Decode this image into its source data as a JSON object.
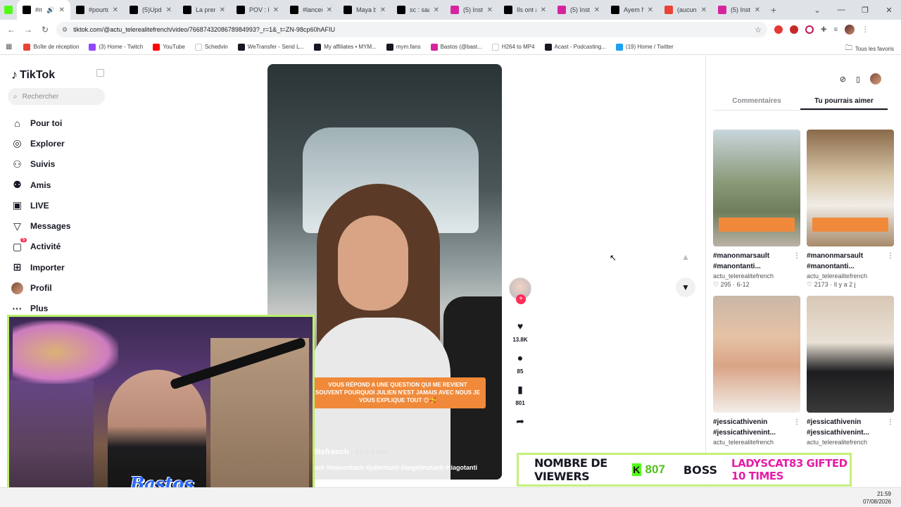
{
  "browser": {
    "tabs": [
      {
        "label": "",
        "icon": "kick-icon",
        "color": "#53fc18"
      },
      {
        "label": "#ma",
        "icon": "tiktok-icon",
        "color": "#000000",
        "active": true
      },
      {
        "label": "#pourto",
        "icon": "tiktok-icon",
        "color": "#000000"
      },
      {
        "label": "(5)Upda",
        "icon": "tiktok-icon",
        "color": "#000000"
      },
      {
        "label": "La prem",
        "icon": "tiktok-icon",
        "color": "#000000"
      },
      {
        "label": "POV : Le",
        "icon": "tiktok-icon",
        "color": "#000000"
      },
      {
        "label": "#lanceu",
        "icon": "tiktok-icon",
        "color": "#000000"
      },
      {
        "label": "Maya b",
        "icon": "tiktok-icon",
        "color": "#000000"
      },
      {
        "label": "sc : saal",
        "icon": "tiktok-icon",
        "color": "#000000"
      },
      {
        "label": "(5) Insta",
        "icon": "instagram-icon",
        "color": "#d6249f"
      },
      {
        "label": "Ils ont a",
        "icon": "tiktok-icon",
        "color": "#000000"
      },
      {
        "label": "(5) Insta",
        "icon": "instagram-icon",
        "color": "#d6249f"
      },
      {
        "label": "Ayem N",
        "icon": "tiktok-icon",
        "color": "#000000"
      },
      {
        "label": "(aucun",
        "icon": "gmail-icon",
        "color": "#ea4335"
      },
      {
        "label": "(5) Insta",
        "icon": "instagram-icon",
        "color": "#d6249f"
      }
    ],
    "new_tab": "+",
    "url": "tiktok.com/@actu_telerealitefrench/video/7668743208678984993?_r=1&_t=ZN-98cp60hAFIU",
    "bookmarks": [
      {
        "label": "Boîte de réception",
        "color": "#ea4335"
      },
      {
        "label": "(3) Home - Twitch",
        "color": "#9146ff"
      },
      {
        "label": "YouTube",
        "color": "#ff0000"
      },
      {
        "label": "Schedvin",
        "color": "#ffffff"
      },
      {
        "label": "WeTransfer - Send L...",
        "color": "#161823"
      },
      {
        "label": "My affiliates • MYM...",
        "color": "#161823"
      },
      {
        "label": "mym.fans",
        "color": "#161823"
      },
      {
        "label": "Bastos (@bast...",
        "color": "#d6249f"
      },
      {
        "label": "H264 to MP4",
        "color": "#ffffff"
      },
      {
        "label": "Acast - Podcasting...",
        "color": "#161823"
      },
      {
        "label": "(19) Home / Twitter",
        "color": "#1da1f2"
      }
    ],
    "all_bookmarks": "Tous les favoris"
  },
  "tiktok": {
    "logo": "TikTok",
    "search_placeholder": "Rechercher",
    "nav": [
      {
        "label": "Pour toi",
        "icon": "home-icon",
        "glyph": "⌂"
      },
      {
        "label": "Explorer",
        "icon": "compass-icon",
        "glyph": "◎"
      },
      {
        "label": "Suivis",
        "icon": "following-icon",
        "glyph": "⚇"
      },
      {
        "label": "Amis",
        "icon": "friends-icon",
        "glyph": "⚉"
      },
      {
        "label": "LIVE",
        "icon": "live-icon",
        "glyph": "▣"
      },
      {
        "label": "Messages",
        "icon": "messages-icon",
        "glyph": "▽"
      },
      {
        "label": "Activité",
        "icon": "activity-icon",
        "glyph": "▢",
        "badge": "5"
      },
      {
        "label": "Importer",
        "icon": "upload-icon",
        "glyph": "⊞"
      },
      {
        "label": "Profil",
        "icon": "profile-avatar",
        "glyph": ""
      },
      {
        "label": "Plus",
        "icon": "more-icon",
        "glyph": "···"
      }
    ],
    "video": {
      "sticker": "VOUS RÉPOND A UNE QUESTION QUI ME REVIENT SOUVENT POURQUOI JULIEN N'EST JAMAIS AVEC NOUS JE VOUS EXPLIQUE TOUT 😊🥰",
      "author": "alitefrench",
      "posted": "· Il y a 1 sem",
      "tags": "sault #manontanti #julientanti #angelinatanti #tiagotanti"
    },
    "actions": {
      "likes": "13.8K",
      "comments": "85",
      "saves": "801"
    },
    "panel_tabs": {
      "comments": "Commentaires",
      "suggested": "Tu pourrais aimer"
    },
    "suggested": [
      {
        "title": "#manonmarsault #manontanti...",
        "author": "actu_telerealitefrench",
        "likes": "295",
        "date": "6-12",
        "bg": "linear-gradient(180deg,#c9d6dc 0%,#8a9a78 45%,#6f7d5c 70%,#b9b2a5 100%)"
      },
      {
        "title": "#manonmarsault #manontanti...",
        "author": "actu_telerealitefrench",
        "likes": "2173",
        "date": "Il y a 2 j",
        "bg": "linear-gradient(180deg,#8a6a4a 0%,#d8c6a8 40%,#f0ece6 65%,#a78a6a 100%)"
      },
      {
        "title": "#jessicathivenin #jessicathivenint...",
        "author": "actu_telerealitefrench",
        "likes": "",
        "date": "",
        "bg": "linear-gradient(180deg,#c9b7a6 0%,#e6c2a5 35%,#d9a486 60%,#f2ede8 100%)"
      },
      {
        "title": "#jessicathivenin #jessicathivenint...",
        "author": "actu_telerealitefrench",
        "likes": "",
        "date": "",
        "bg": "linear-gradient(180deg,#d8c7b5 0%,#e9e1d5 40%,#1d1d1f 65%,#3a3a3a 100%)"
      }
    ]
  },
  "stream": {
    "brand": "Bastos",
    "viewers_label": "NOMBRE DE VIEWERS",
    "kick_letter": "K",
    "viewer_count": "807",
    "boss_label": "BOSS",
    "gift_text": "LADYSCAT83 GIFTED 10 TIMES"
  },
  "taskbar": {
    "time": "21:59",
    "date": "07/08/2026"
  }
}
